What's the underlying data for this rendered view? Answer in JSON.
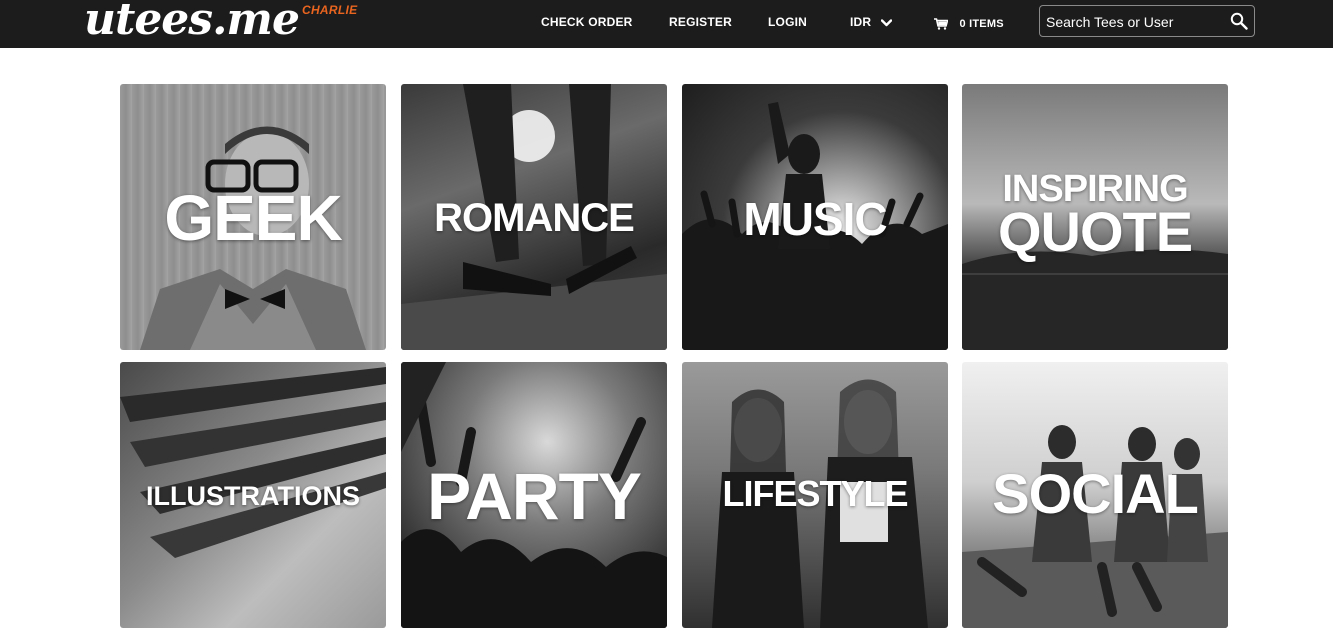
{
  "header": {
    "logo": "utees.me",
    "logo_sub": "CHARLIE",
    "nav": {
      "check_order": "CHECK ORDER",
      "register": "REGISTER",
      "login": "LOGIN",
      "currency": "IDR",
      "cart_count": "0 ITEMS"
    },
    "search": {
      "placeholder": "Search Tees or User"
    },
    "icons": {
      "currency_dropdown": "chevron-down-icon",
      "cart": "cart-icon",
      "search": "search-icon"
    }
  },
  "categories": [
    {
      "label": "GEEK"
    },
    {
      "label": "ROMANCE"
    },
    {
      "label": "MUSIC"
    },
    {
      "label_line1": "INSPIRING",
      "label_line2": "QUOTE"
    },
    {
      "label": "ILLUSTRATIONS"
    },
    {
      "label": "PARTY"
    },
    {
      "label": "LIFESTYLE"
    },
    {
      "label": "SOCIAL"
    }
  ],
  "colors": {
    "header_bg": "#1c1c1c",
    "logo_accent": "#e8641f",
    "page_bg": "#ffffff"
  }
}
